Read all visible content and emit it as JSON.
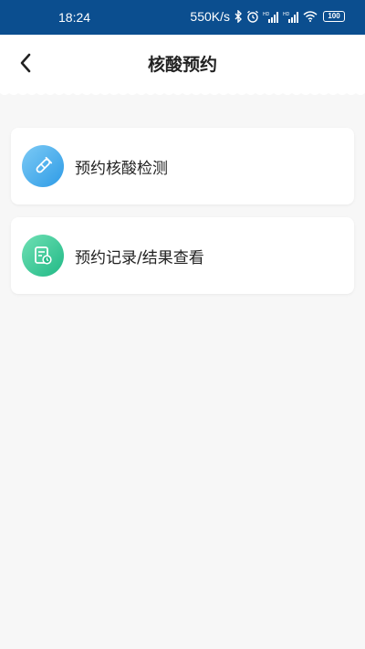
{
  "status_bar": {
    "time": "18:24",
    "speed": "550K/s",
    "battery": "100",
    "icons": [
      "bluetooth-icon",
      "alarm-icon",
      "signal-hd-icon",
      "signal-hd-icon",
      "wifi-icon",
      "battery-icon"
    ],
    "background": "#0b4e8f"
  },
  "header": {
    "title": "核酸预约",
    "back_icon": "chevron-left-icon"
  },
  "menu": {
    "items": [
      {
        "label": "预约核酸检测",
        "icon": "test-tube-icon",
        "color": "#2e9be6"
      },
      {
        "label": "预约记录/结果查看",
        "icon": "record-clock-icon",
        "color": "#21b986"
      }
    ]
  }
}
